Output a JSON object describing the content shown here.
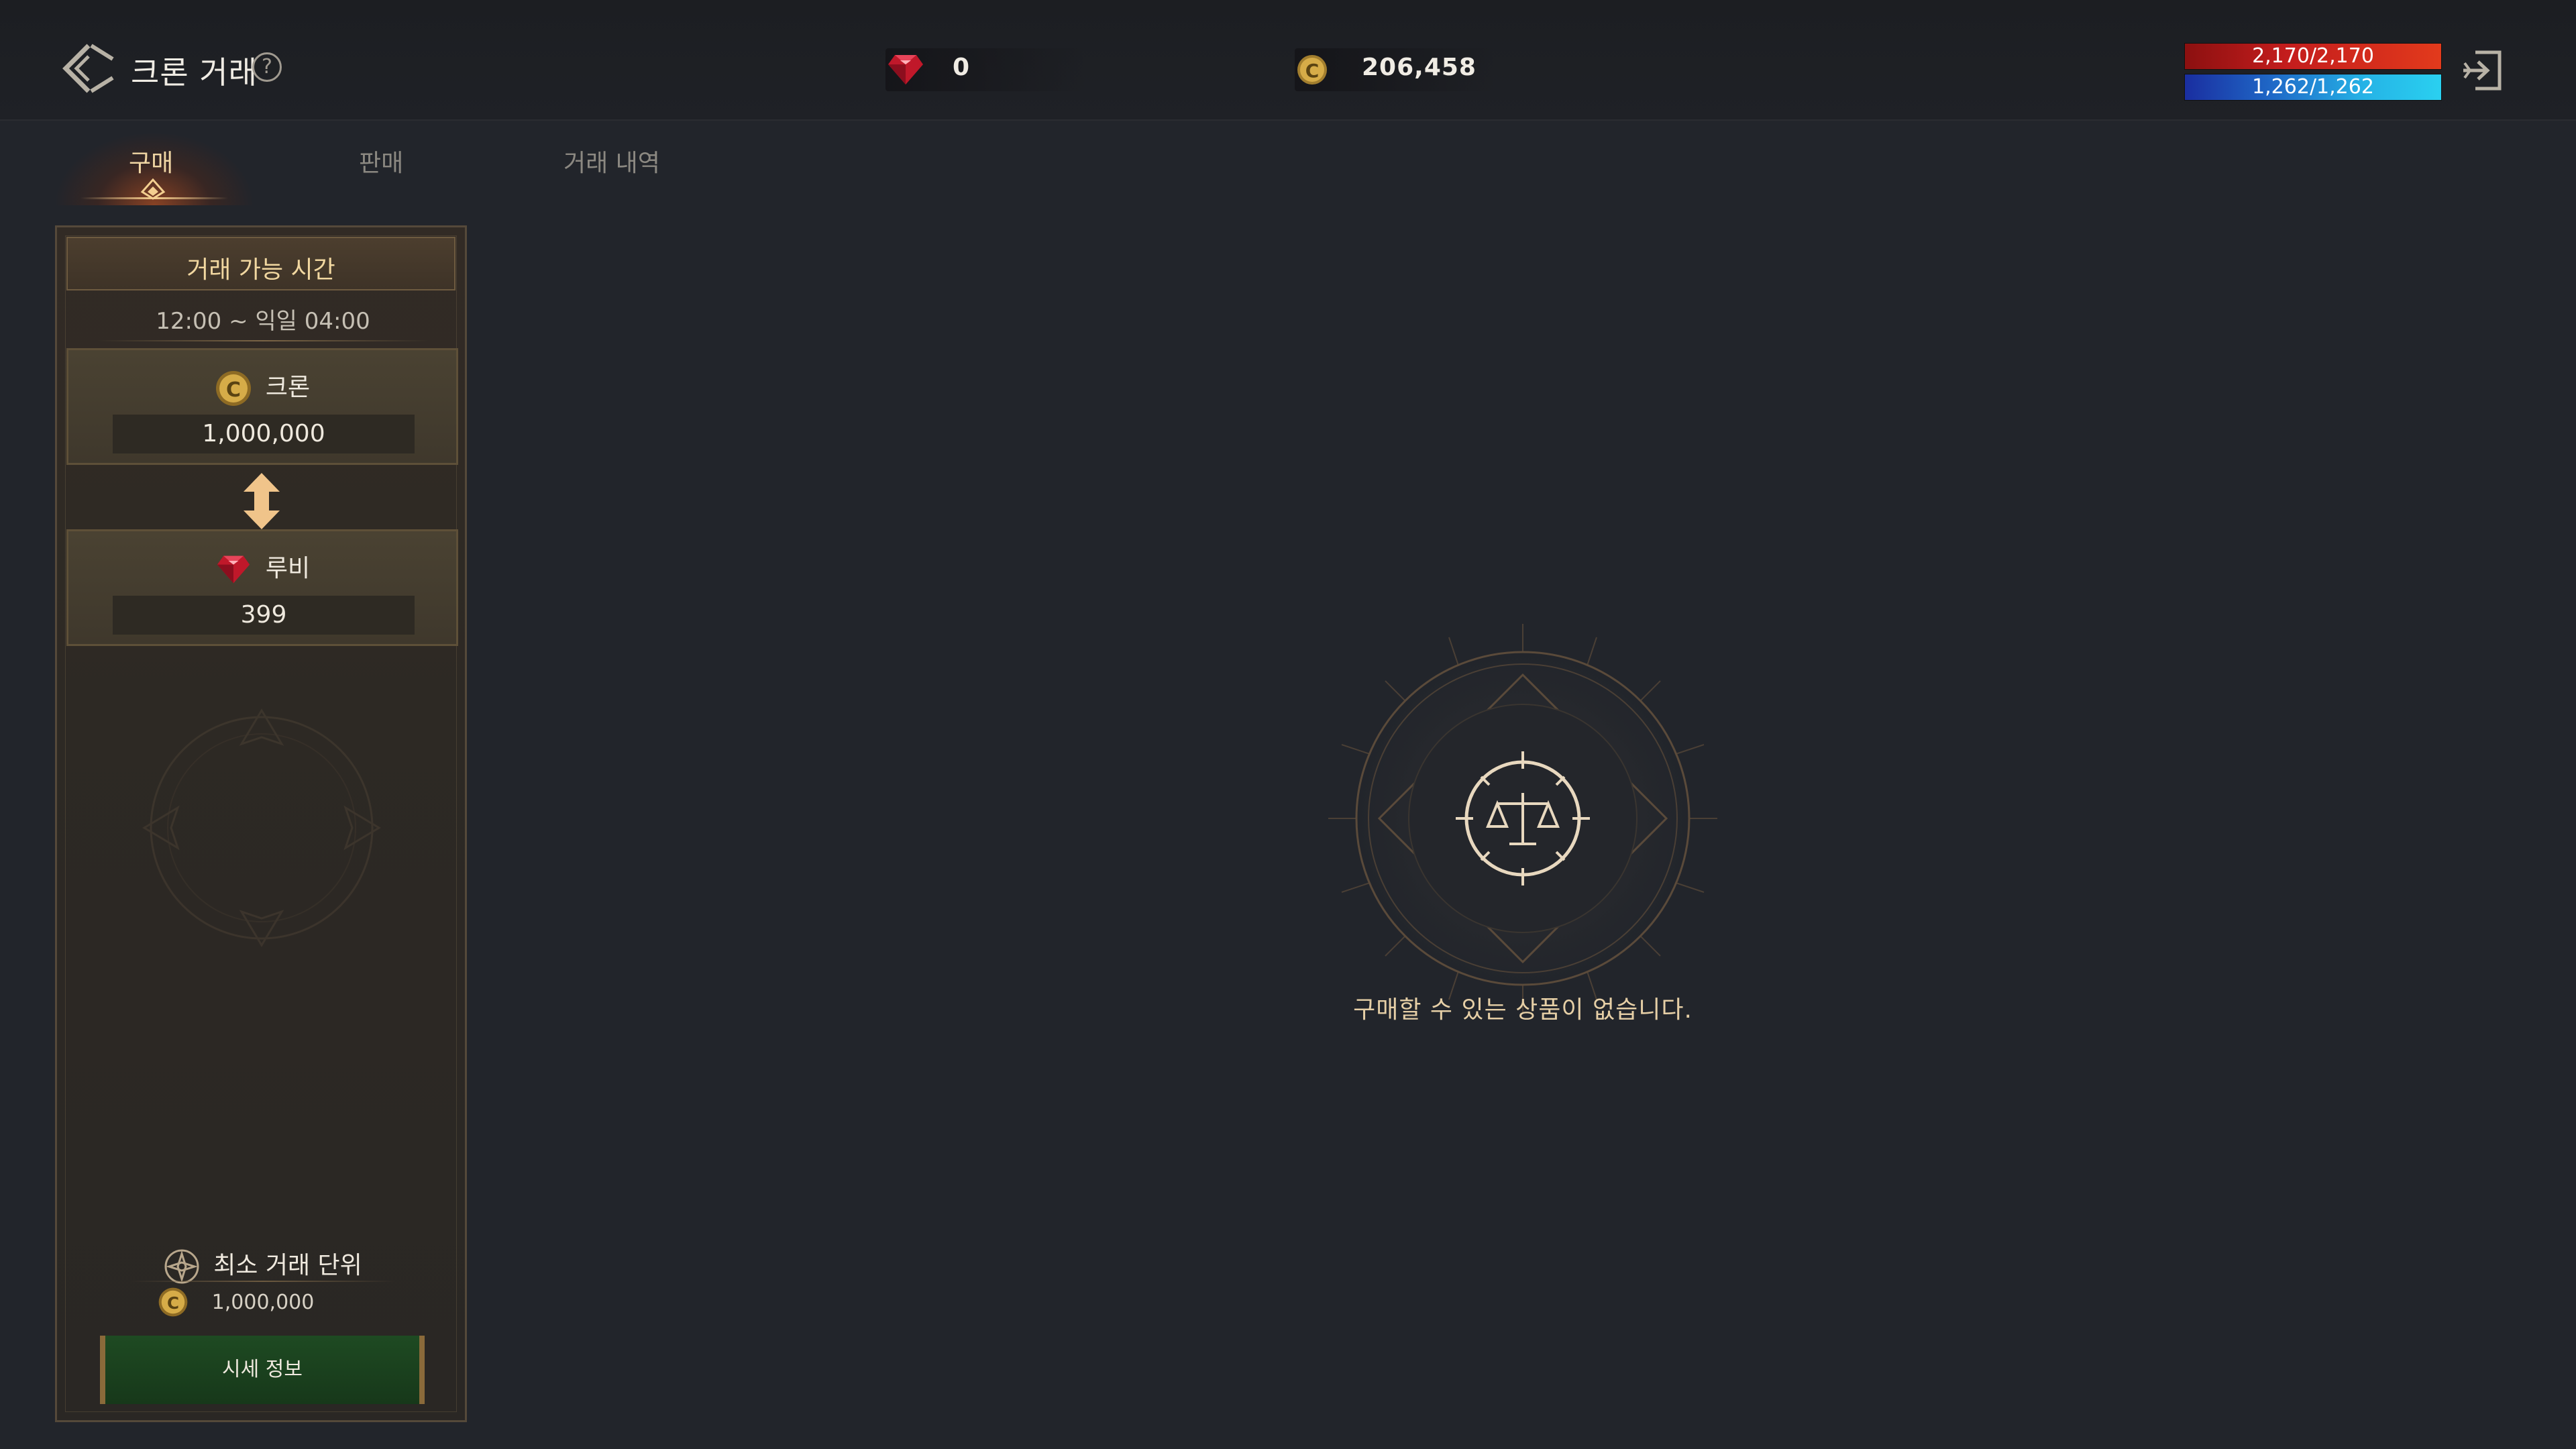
{
  "header": {
    "title": "크론 거래",
    "help": "?",
    "ruby_amount": "0",
    "cron_amount": "206,458",
    "hp": "2,170/2,170",
    "mp": "1,262/1,262"
  },
  "tabs": [
    {
      "label": "구매",
      "active": true
    },
    {
      "label": "판매",
      "active": false
    },
    {
      "label": "거래 내역",
      "active": false
    }
  ],
  "panel": {
    "avail_title": "거래 가능 시간",
    "avail_time": "12:00 ~ 익일 04:00",
    "from": {
      "label": "크론",
      "value": "1,000,000"
    },
    "to": {
      "label": "루비",
      "value": "399"
    },
    "min_unit_label": "최소 거래 단위",
    "min_unit_value": "1,000,000",
    "price_button": "시세 정보"
  },
  "empty_message": "구매할 수 있는 상품이 없습니다.",
  "colors": {
    "accent_gold": "#f1d7a0",
    "hp_red": "#c41d1d",
    "mp_blue": "#25b3e6",
    "button_green": "#1e4a22"
  }
}
